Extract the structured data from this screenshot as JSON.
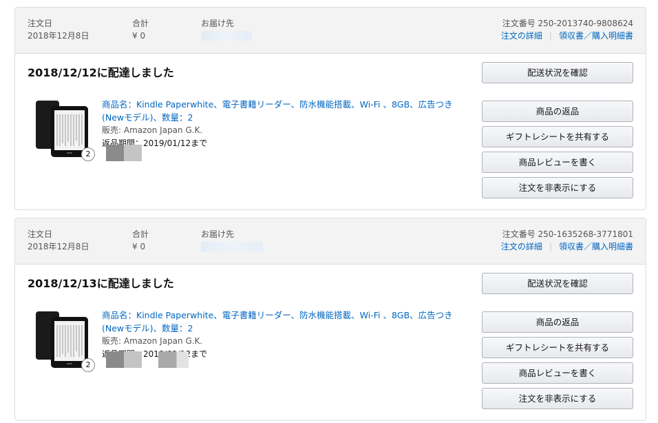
{
  "orders": [
    {
      "header": {
        "order_date_label": "注文日",
        "order_date": "2018年12月8日",
        "total_label": "合計",
        "total": "¥ 0",
        "ship_to_label": "お届け先",
        "order_number": "注文番号 250-2013740-9808624",
        "details_link": "注文の詳細",
        "receipt_link": "領収書／購入明細書"
      },
      "delivered": "2018/12/12に配達しました",
      "item": {
        "title": "商品名：Kindle Paperwhite、電子書籍リーダー、防水機能搭載、Wi-Fi 、8GB、広告つき(Newモデル)、数量：2",
        "seller": "販売: Amazon Japan G.K.",
        "return_period": "返品期間：2019/01/12まで",
        "quantity_badge": "2"
      },
      "buttons": {
        "track": "配送状況を確認",
        "return": "商品の返品",
        "gift": "ギフトレシートを共有する",
        "review": "商品レビューを書く",
        "hide": "注文を非表示にする"
      }
    },
    {
      "header": {
        "order_date_label": "注文日",
        "order_date": "2018年12月8日",
        "total_label": "合計",
        "total": "¥ 0",
        "ship_to_label": "お届け先",
        "order_number": "注文番号 250-1635268-3771801",
        "details_link": "注文の詳細",
        "receipt_link": "領収書／購入明細書"
      },
      "delivered": "2018/12/13に配達しました",
      "item": {
        "title": "商品名：Kindle Paperwhite、電子書籍リーダー、防水機能搭載、Wi-Fi 、8GB、広告つき(Newモデル)、数量：2",
        "seller": "販売: Amazon Japan G.K.",
        "return_period": "返品期間：2019/01/12まで",
        "quantity_badge": "2"
      },
      "buttons": {
        "track": "配送状況を確認",
        "return": "商品の返品",
        "gift": "ギフトレシートを共有する",
        "review": "商品レビューを書く",
        "hide": "注文を非表示にする"
      }
    }
  ],
  "colors": {
    "link": "#0066c0",
    "header_bg": "#f3f3f3",
    "border": "#dddddd"
  },
  "icons": {
    "product": "kindle-device-icon"
  }
}
